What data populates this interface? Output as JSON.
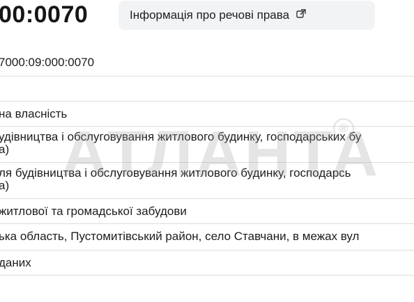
{
  "header": {
    "cadastral_title": "00:0070",
    "rights_button_label": "Інформація про речові права",
    "rights_button_icon": "external-link-icon"
  },
  "rows": [
    {
      "text": "7000:09:000:0070"
    },
    {
      "text": ""
    },
    {
      "text": "на власність"
    },
    {
      "text": "удівництва і обслуговування житлового будинку, господарських бу",
      "text2": "а)"
    },
    {
      "text": "ля будівництва і обслуговування житлового будинку, господарсь",
      "text2": "а)"
    },
    {
      "text": "житлової та громадської забудови"
    },
    {
      "text": "ька область, Пустомитівський район, село Ставчани, в межах вул"
    },
    {
      "text": "даних"
    }
  ],
  "watermark": {
    "text": "АТЛАНТА",
    "mark": "®"
  }
}
